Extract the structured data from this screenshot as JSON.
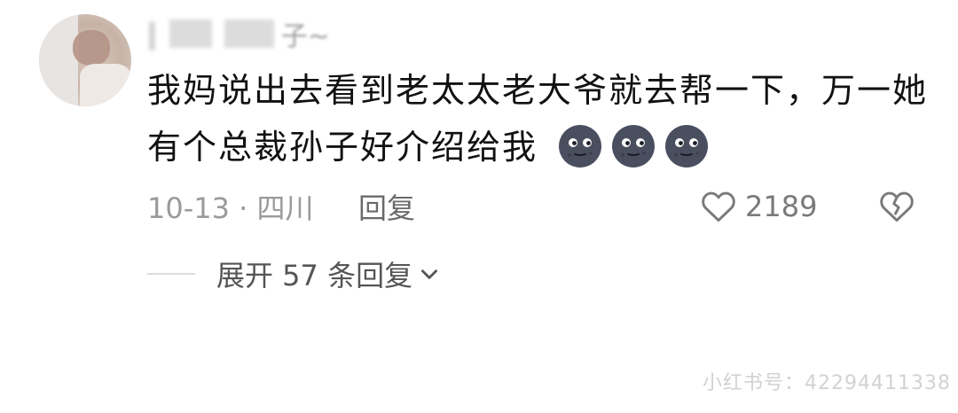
{
  "comment": {
    "username": "",
    "username_tail": "子~",
    "text": "我妈说出去看到老太太老大爷就去帮一下，万一她有个总裁孙子好介绍给我",
    "emojis": [
      "dark-moon-face-emoji",
      "dark-moon-face-emoji",
      "dark-moon-face-emoji"
    ],
    "date_location": "10-13 · 四川",
    "reply_label": "回复",
    "like_count": "2189",
    "expand_label": "展开 57 条回复"
  },
  "watermark": {
    "text": "小红书号：422944113​38"
  },
  "icons": {
    "like": "heart-outline-icon",
    "dislike": "broken-heart-icon",
    "expand": "chevron-down-icon"
  },
  "colors": {
    "text_primary": "#111111",
    "text_muted": "#9a9a9a",
    "text_action": "#6a6a6a",
    "icon": "#7a7a7a",
    "emoji": "#4a4f60"
  }
}
